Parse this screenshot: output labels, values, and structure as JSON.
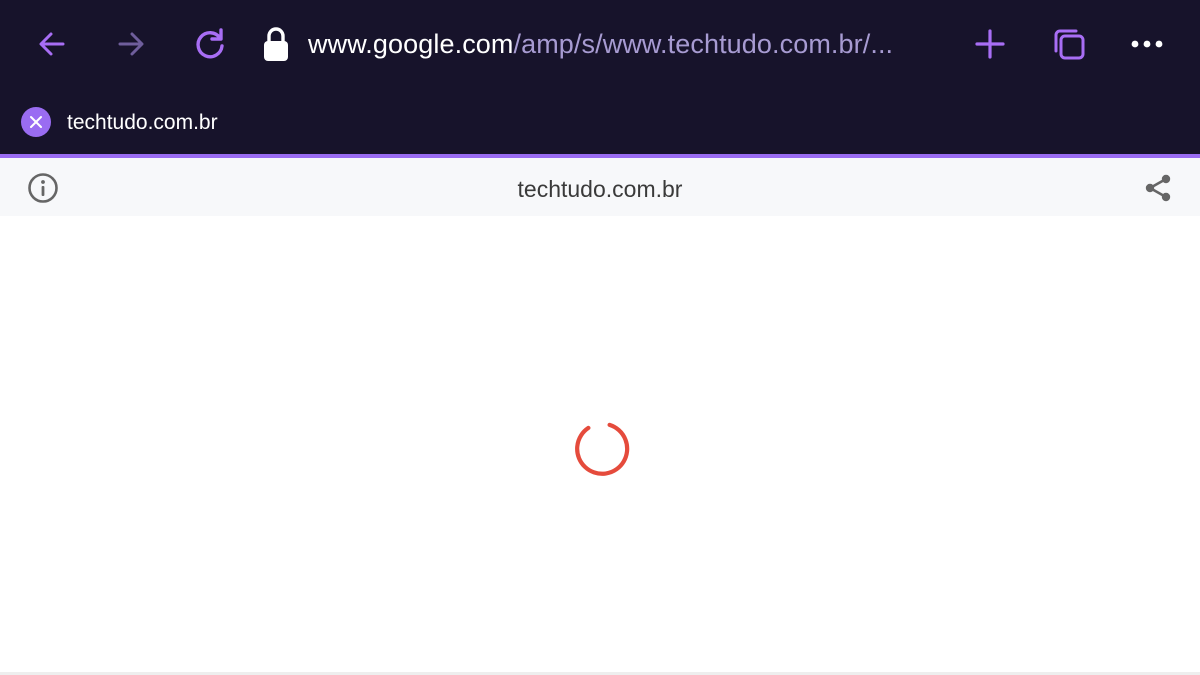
{
  "toolbar": {
    "url_host": "www.google.com",
    "url_rest": "/amp/s/www.techtudo.com.br/...",
    "icons": {
      "back": "arrow-left-icon",
      "forward": "arrow-right-icon",
      "reload": "reload-icon",
      "lock": "lock-icon",
      "new_tab": "plus-icon",
      "tabs": "tabs-icon",
      "menu": "more-icon"
    }
  },
  "tab": {
    "title": "techtudo.com.br",
    "close_icon": "close-icon"
  },
  "amp_header": {
    "domain": "techtudo.com.br",
    "info_icon": "info-icon",
    "share_icon": "share-icon"
  },
  "content": {
    "loading_indicator": "spinner"
  },
  "colors": {
    "chrome_background": "#17132b",
    "accent": "#9a6cf2",
    "url_path": "#a79bd2",
    "header_background": "#f7f8fa",
    "spinner": "#e54b3c"
  }
}
